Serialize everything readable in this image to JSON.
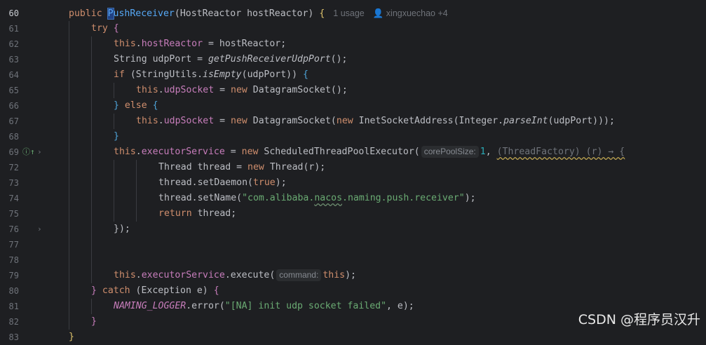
{
  "editor": {
    "lines": [
      {
        "num": "60",
        "current": true,
        "parts": [
          {
            "t": "public ",
            "c": "kw"
          },
          {
            "t": "P",
            "c": "caret-sel"
          },
          {
            "t": "ushReceiver",
            "c": "fn-decl"
          },
          {
            "t": "(HostReactor hostReactor) "
          },
          {
            "t": "{",
            "c": "bg-a"
          },
          {
            "t": "1 usage",
            "c": "meta"
          },
          {
            "t": "👤 xingxuechao +4",
            "c": "meta"
          }
        ],
        "indent": 0
      },
      {
        "num": "61",
        "parts": [
          {
            "t": "try ",
            "c": "kw"
          },
          {
            "t": "{",
            "c": "bg-b"
          }
        ],
        "indent": 1
      },
      {
        "num": "62",
        "parts": [
          {
            "t": "this",
            "c": "kw"
          },
          {
            "t": "."
          },
          {
            "t": "hostReactor",
            "c": "fld"
          },
          {
            "t": " = hostReactor;"
          }
        ],
        "indent": 2
      },
      {
        "num": "63",
        "parts": [
          {
            "t": "String udpPort = "
          },
          {
            "t": "getPushReceiverUdpPort",
            "c": "ital"
          },
          {
            "t": "();"
          }
        ],
        "indent": 2
      },
      {
        "num": "64",
        "parts": [
          {
            "t": "if ",
            "c": "kw"
          },
          {
            "t": "(StringUtils."
          },
          {
            "t": "isEmpty",
            "c": "ital"
          },
          {
            "t": "(udpPort)) "
          },
          {
            "t": "{",
            "c": "bg-c"
          }
        ],
        "indent": 2
      },
      {
        "num": "65",
        "parts": [
          {
            "t": "this",
            "c": "kw"
          },
          {
            "t": "."
          },
          {
            "t": "udpSocket",
            "c": "fld"
          },
          {
            "t": " = "
          },
          {
            "t": "new ",
            "c": "kw"
          },
          {
            "t": "DatagramSocket();"
          }
        ],
        "indent": 3
      },
      {
        "num": "66",
        "parts": [
          {
            "t": "}",
            "c": "bg-c"
          },
          {
            "t": " else ",
            "c": "kw"
          },
          {
            "t": "{",
            "c": "bg-c"
          }
        ],
        "indent": 2
      },
      {
        "num": "67",
        "parts": [
          {
            "t": "this",
            "c": "kw"
          },
          {
            "t": "."
          },
          {
            "t": "udpSocket",
            "c": "fld"
          },
          {
            "t": " = "
          },
          {
            "t": "new ",
            "c": "kw"
          },
          {
            "t": "DatagramSocket("
          },
          {
            "t": "new ",
            "c": "kw"
          },
          {
            "t": "InetSocketAddress(Integer."
          },
          {
            "t": "parseInt",
            "c": "ital"
          },
          {
            "t": "(udpPort)));"
          }
        ],
        "indent": 3
      },
      {
        "num": "68",
        "parts": [
          {
            "t": "}",
            "c": "bg-c"
          }
        ],
        "indent": 2
      },
      {
        "num": "69",
        "icons": true,
        "parts": [
          {
            "t": "this",
            "c": "kw"
          },
          {
            "t": "."
          },
          {
            "t": "executorService",
            "c": "fld"
          },
          {
            "t": " = "
          },
          {
            "t": "new ",
            "c": "kw"
          },
          {
            "t": "ScheduledThreadPoolExecutor("
          },
          {
            "t": "corePoolSize:",
            "c": "hint"
          },
          {
            "t": "1",
            "c": "num-lit"
          },
          {
            "t": ", "
          },
          {
            "t": "(ThreadFactory) (r) → {",
            "c": "lambda-hint"
          }
        ],
        "indent": 2
      },
      {
        "num": "72",
        "parts": [
          {
            "t": "Thread thread = "
          },
          {
            "t": "new ",
            "c": "kw"
          },
          {
            "t": "Thread(r);"
          }
        ],
        "indent": 4
      },
      {
        "num": "73",
        "parts": [
          {
            "t": "thread.setDaemon("
          },
          {
            "t": "true",
            "c": "kw"
          },
          {
            "t": ");"
          }
        ],
        "indent": 4
      },
      {
        "num": "74",
        "parts": [
          {
            "t": "thread.setName("
          },
          {
            "t": "\"com.alibaba.",
            "c": "str"
          },
          {
            "t": "nacos",
            "c": "str squig"
          },
          {
            "t": ".naming.push.receiver\"",
            "c": "str"
          },
          {
            "t": ");"
          }
        ],
        "indent": 4
      },
      {
        "num": "75",
        "parts": [
          {
            "t": "return ",
            "c": "kw"
          },
          {
            "t": "thread;"
          }
        ],
        "indent": 4
      },
      {
        "num": "76",
        "fold": true,
        "parts": [
          {
            "t": "}"
          },
          {
            "t": ");"
          }
        ],
        "indent": 2
      },
      {
        "num": "77",
        "parts": [],
        "indent": 2
      },
      {
        "num": "78",
        "parts": [],
        "indent": 2
      },
      {
        "num": "79",
        "parts": [
          {
            "t": "this",
            "c": "kw"
          },
          {
            "t": "."
          },
          {
            "t": "executorService",
            "c": "fld"
          },
          {
            "t": ".execute("
          },
          {
            "t": "command:",
            "c": "hint"
          },
          {
            "t": "this",
            "c": "kw"
          },
          {
            "t": ");"
          }
        ],
        "indent": 2
      },
      {
        "num": "80",
        "parts": [
          {
            "t": "}",
            "c": "bg-b"
          },
          {
            "t": " catch ",
            "c": "kw"
          },
          {
            "t": "(Exception e) "
          },
          {
            "t": "{",
            "c": "bg-b"
          }
        ],
        "indent": 1
      },
      {
        "num": "81",
        "parts": [
          {
            "t": "NAMING_LOGGER",
            "c": "const"
          },
          {
            "t": ".error("
          },
          {
            "t": "\"[NA] init udp socket failed\"",
            "c": "str"
          },
          {
            "t": ", e);"
          }
        ],
        "indent": 2
      },
      {
        "num": "82",
        "parts": [
          {
            "t": "}",
            "c": "bg-b"
          }
        ],
        "indent": 1
      },
      {
        "num": "83",
        "parts": [
          {
            "t": "}",
            "c": "bg-a"
          }
        ],
        "indent": 0
      }
    ]
  },
  "gutter_icons": {
    "implement_icon": "ⓘ↑",
    "fold_arrow": "›"
  },
  "watermark": "CSDN @程序员汉升"
}
